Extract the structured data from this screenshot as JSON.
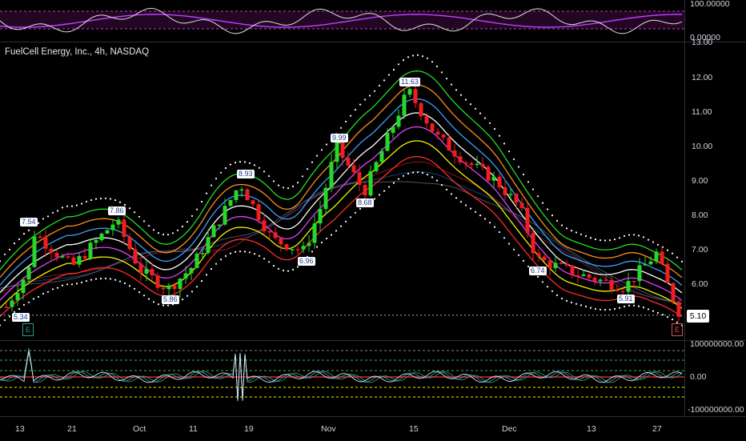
{
  "legend": {
    "text": "FuelCell Energy, Inc., 4h, NASDAQ"
  },
  "top_axis": [
    "100.00000",
    "0.00000"
  ],
  "price_axis": [
    "13.00",
    "12.00",
    "11.00",
    "10.00",
    "9.00",
    "8.00",
    "7.00",
    "6.00",
    "5.00"
  ],
  "current_price": "5.10",
  "bottom_axis": [
    "100000000.00",
    "0.00",
    "-100000000.00"
  ],
  "time_axis": [
    "13",
    "21",
    "Oct",
    "11",
    "19",
    "Nov",
    "15",
    "Dec",
    "13",
    "27"
  ],
  "earnings_markers": [
    "E",
    "E"
  ],
  "price_labels": [
    "5.34",
    "7.54",
    "7.86",
    "5.86",
    "8.93",
    "6.96",
    "9.99",
    "8.68",
    "11.63",
    "6.74",
    "5.91"
  ],
  "colors": {
    "background": "#000000",
    "up_candle": "#26d82a",
    "down_candle": "#f01e1e",
    "band_white": "#ffffff",
    "band_green": "#22dd22",
    "band_orange": "#ff8c1a",
    "band_blue": "#3aa0ff",
    "band_magenta": "#e040fb",
    "band_yellow": "#f5f500",
    "band_red": "#ff2a2a",
    "osc_purple": "#c040ff"
  },
  "chart_data": {
    "type": "candlestick",
    "title": "FuelCell Energy, Inc., 4h, NASDAQ",
    "x": [
      "13",
      "21",
      "Oct",
      "11",
      "19",
      "Nov",
      "15",
      "Dec",
      "13",
      "27"
    ],
    "ylim": [
      5.0,
      13.0
    ],
    "series": [
      {
        "name": "",
        "values": [
          5.34,
          6.6,
          7.54,
          6.5,
          7.86,
          6.4,
          5.86,
          6.5,
          8.93,
          7.3,
          6.96,
          8.2,
          9.99,
          8.68,
          11.63,
          10.3,
          9.6,
          9.0,
          8.2,
          6.74,
          6.3,
          5.91,
          6.4,
          6.9,
          5.9,
          5.1
        ]
      }
    ],
    "grid": false
  }
}
